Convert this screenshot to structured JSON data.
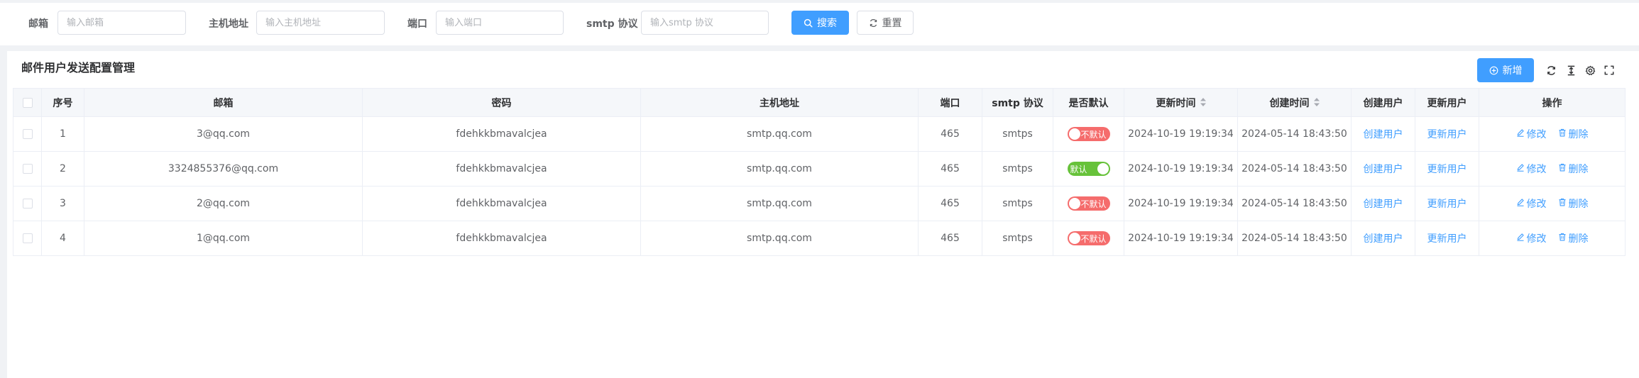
{
  "search": {
    "email_label": "邮箱",
    "email_placeholder": "输入邮箱",
    "host_label": "主机地址",
    "host_placeholder": "输入主机地址",
    "port_label": "端口",
    "port_placeholder": "输入端口",
    "smtp_label": "smtp 协议",
    "smtp_placeholder": "输入smtp 协议",
    "search_button": "搜索",
    "reset_button": "重置"
  },
  "card": {
    "title": "邮件用户发送配置管理",
    "add_button": "新增"
  },
  "table": {
    "headers": {
      "index": "序号",
      "email": "邮箱",
      "password": "密码",
      "host": "主机地址",
      "port": "端口",
      "smtp": "smtp 协议",
      "is_default": "是否默认",
      "updated_at": "更新时间",
      "created_at": "创建时间",
      "created_by": "创建用户",
      "updated_by": "更新用户",
      "actions": "操作"
    },
    "edit_label": "修改",
    "delete_label": "删除",
    "rows": [
      {
        "index": "1",
        "email": "3@qq.com",
        "password": "fdehkkbmavalcjea",
        "host": "smtp.qq.com",
        "port": "465",
        "smtp": "smtps",
        "default_state": "off",
        "default_text": "不默认",
        "updated_at": "2024-10-19 19:19:34",
        "created_at": "2024-05-14 18:43:50",
        "created_by": "创建用户",
        "updated_by": "更新用户"
      },
      {
        "index": "2",
        "email": "3324855376@qq.com",
        "password": "fdehkkbmavalcjea",
        "host": "smtp.qq.com",
        "port": "465",
        "smtp": "smtps",
        "default_state": "on",
        "default_text": "默认",
        "updated_at": "2024-10-19 19:19:34",
        "created_at": "2024-05-14 18:43:50",
        "created_by": "创建用户",
        "updated_by": "更新用户"
      },
      {
        "index": "3",
        "email": "2@qq.com",
        "password": "fdehkkbmavalcjea",
        "host": "smtp.qq.com",
        "port": "465",
        "smtp": "smtps",
        "default_state": "off",
        "default_text": "不默认",
        "updated_at": "2024-10-19 19:19:34",
        "created_at": "2024-05-14 18:43:50",
        "created_by": "创建用户",
        "updated_by": "更新用户"
      },
      {
        "index": "4",
        "email": "1@qq.com",
        "password": "fdehkkbmavalcjea",
        "host": "smtp.qq.com",
        "port": "465",
        "smtp": "smtps",
        "default_state": "off",
        "default_text": "不默认",
        "updated_at": "2024-10-19 19:19:34",
        "created_at": "2024-05-14 18:43:50",
        "created_by": "创建用户",
        "updated_by": "更新用户"
      }
    ]
  },
  "colors": {
    "primary": "#409eff",
    "switch_on": "#67c23a",
    "switch_off": "#f56c6c"
  },
  "icons": {
    "search": "search-icon",
    "reset": "refresh-icon",
    "add": "plus-circle-icon",
    "refresh": "refresh-icon",
    "density": "column-height-icon",
    "settings": "gear-icon",
    "fullscreen": "fullscreen-icon",
    "edit": "edit-icon",
    "delete": "trash-icon"
  }
}
